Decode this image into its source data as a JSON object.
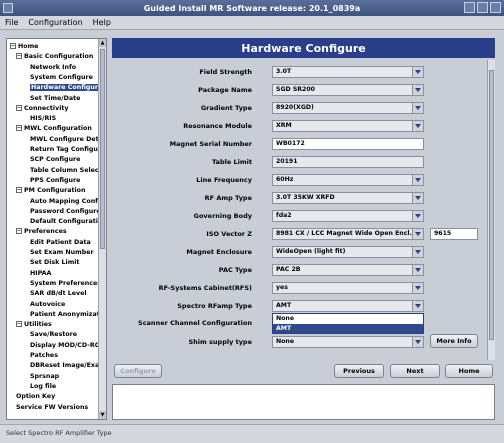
{
  "window": {
    "title": "Guided Install  MR Software release: 20.1_0839a"
  },
  "menu": {
    "items": [
      "File",
      "Configuration",
      "Help"
    ]
  },
  "tree": {
    "items": [
      {
        "label": "Home",
        "level": 0,
        "expandable": true,
        "expanded": true
      },
      {
        "label": "Basic Configuration",
        "level": 1,
        "expandable": true,
        "expanded": true
      },
      {
        "label": "Network Info",
        "level": 2
      },
      {
        "label": "System Configure",
        "level": 2
      },
      {
        "label": "Hardware Configure",
        "level": 2,
        "selected": true
      },
      {
        "label": "Set Time/Date",
        "level": 2
      },
      {
        "label": "Connectivity",
        "level": 1,
        "expandable": true,
        "expanded": true
      },
      {
        "label": "HIS/RIS",
        "level": 2
      },
      {
        "label": "MWL Configuration",
        "level": 1,
        "expandable": true,
        "expanded": true
      },
      {
        "label": "MWL Configure Details",
        "level": 2
      },
      {
        "label": "Return Tag Configure",
        "level": 2
      },
      {
        "label": "SCP Configure",
        "level": 2
      },
      {
        "label": "Table Column Selection",
        "level": 2
      },
      {
        "label": "PPS Configure",
        "level": 2
      },
      {
        "label": "PM Configuration",
        "level": 1,
        "expandable": true,
        "expanded": true
      },
      {
        "label": "Auto Mapping Configure",
        "level": 2
      },
      {
        "label": "Password Configure",
        "level": 2
      },
      {
        "label": "Default Configuration",
        "level": 2
      },
      {
        "label": "Preferences",
        "level": 1,
        "expandable": true,
        "expanded": true
      },
      {
        "label": "Edit Patient Data",
        "level": 2
      },
      {
        "label": "Set Exam Number",
        "level": 2
      },
      {
        "label": "Set Disk Limit",
        "level": 2
      },
      {
        "label": "HIPAA",
        "level": 2
      },
      {
        "label": "System Preferences",
        "level": 2
      },
      {
        "label": "SAR dB/dt Level",
        "level": 2
      },
      {
        "label": "Autovoice",
        "level": 2
      },
      {
        "label": "Patient Anonymization",
        "level": 2
      },
      {
        "label": "Utilities",
        "level": 1,
        "expandable": true,
        "expanded": true
      },
      {
        "label": "Save/Restore",
        "level": 2
      },
      {
        "label": "Display MOD/CD-ROM",
        "level": 2
      },
      {
        "label": "Patches",
        "level": 2
      },
      {
        "label": "DBReset Image/Exam",
        "level": 2
      },
      {
        "label": "Sprsnap",
        "level": 2
      },
      {
        "label": "Log file",
        "level": 2
      },
      {
        "label": "Option Key",
        "level": 1
      },
      {
        "label": "Service FW Versions",
        "level": 1
      }
    ]
  },
  "panel": {
    "title": "Hardware Configure"
  },
  "form": {
    "rows": [
      {
        "label": "Field Strength",
        "value": "3.0T",
        "type": "select"
      },
      {
        "label": "Package Name",
        "value": "SGD SR200",
        "type": "select"
      },
      {
        "label": "Gradient Type",
        "value": "8920(XGD)",
        "type": "select"
      },
      {
        "label": "Resonance Module",
        "value": "XRM",
        "type": "select"
      },
      {
        "label": "Magnet Serial Number",
        "value": "WB0172",
        "type": "text"
      },
      {
        "label": "Table Limit",
        "value": "20191",
        "type": "readonly"
      },
      {
        "label": "Line Frequency",
        "value": "60Hz",
        "type": "select"
      },
      {
        "label": "RF Amp Type",
        "value": "3.0T 35KW XRFD",
        "type": "select"
      },
      {
        "label": "Governing Body",
        "value": "fda2",
        "type": "select"
      },
      {
        "label": "ISO Vector Z",
        "value": "8981 CX / LCC Magnet Wide Open Encl...",
        "type": "select",
        "extra_value": "9615"
      },
      {
        "label": "Magnet Enclosure",
        "value": "WideOpen (light fit)",
        "type": "select"
      },
      {
        "label": "PAC Type",
        "value": "PAC 2B",
        "type": "select"
      },
      {
        "label": "RF-Systems Cabinet(RFS)",
        "value": "yes",
        "type": "select"
      },
      {
        "label": "Spectro RFamp Type",
        "value": "AMT",
        "type": "select"
      },
      {
        "label": "Scanner Channel Configuration",
        "value": "",
        "type": "popup",
        "options": [
          "None",
          "AMT"
        ],
        "selected_option": "AMT"
      },
      {
        "label": "Shim supply type",
        "value": "None",
        "type": "select"
      }
    ],
    "more_info_label": "More Info"
  },
  "buttons": {
    "configure": "Configure",
    "previous": "Previous",
    "next": "Next",
    "home": "Home"
  },
  "status": {
    "text": "Select Spectro RF Amplifier Type"
  },
  "colors": {
    "header_bg": "#2a3f8c",
    "selection": "#2e4a8a",
    "window_bg": "#c9cdd6"
  }
}
